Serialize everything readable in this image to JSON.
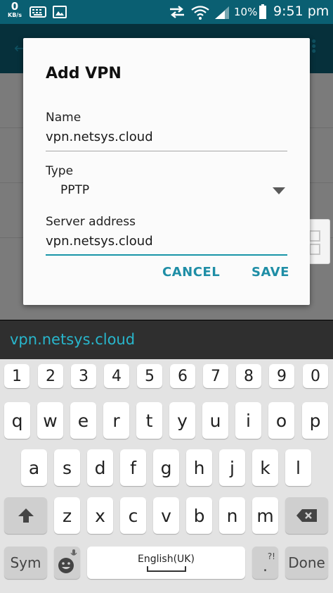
{
  "status_bar": {
    "data_rate_value": "0",
    "data_rate_unit": "KB/s",
    "battery_percent": "10%",
    "time": "9:51 pm"
  },
  "dialog": {
    "title": "Add VPN",
    "name_label": "Name",
    "name_value": "vpn.netsys.cloud",
    "type_label": "Type",
    "type_value": "PPTP",
    "server_label": "Server address",
    "server_value": "vpn.netsys.cloud",
    "cancel_label": "CANCEL",
    "save_label": "SAVE"
  },
  "suggestion": "vpn.netsys.cloud",
  "keyboard": {
    "numbers": [
      "1",
      "2",
      "3",
      "4",
      "5",
      "6",
      "7",
      "8",
      "9",
      "0"
    ],
    "row1": [
      "q",
      "w",
      "e",
      "r",
      "t",
      "y",
      "u",
      "i",
      "o",
      "p"
    ],
    "row2": [
      "a",
      "s",
      "d",
      "f",
      "g",
      "h",
      "j",
      "k",
      "l"
    ],
    "row3": [
      "z",
      "x",
      "c",
      "v",
      "b",
      "n",
      "m"
    ],
    "sym_label": "Sym",
    "space_label": "English(UK)",
    "period_label": ".",
    "period_hint": "?!",
    "done_label": "Done"
  },
  "colors": {
    "accent": "#1f8ea6",
    "status_bar": "#0a5f72",
    "suggestion_text": "#28b6cc"
  }
}
